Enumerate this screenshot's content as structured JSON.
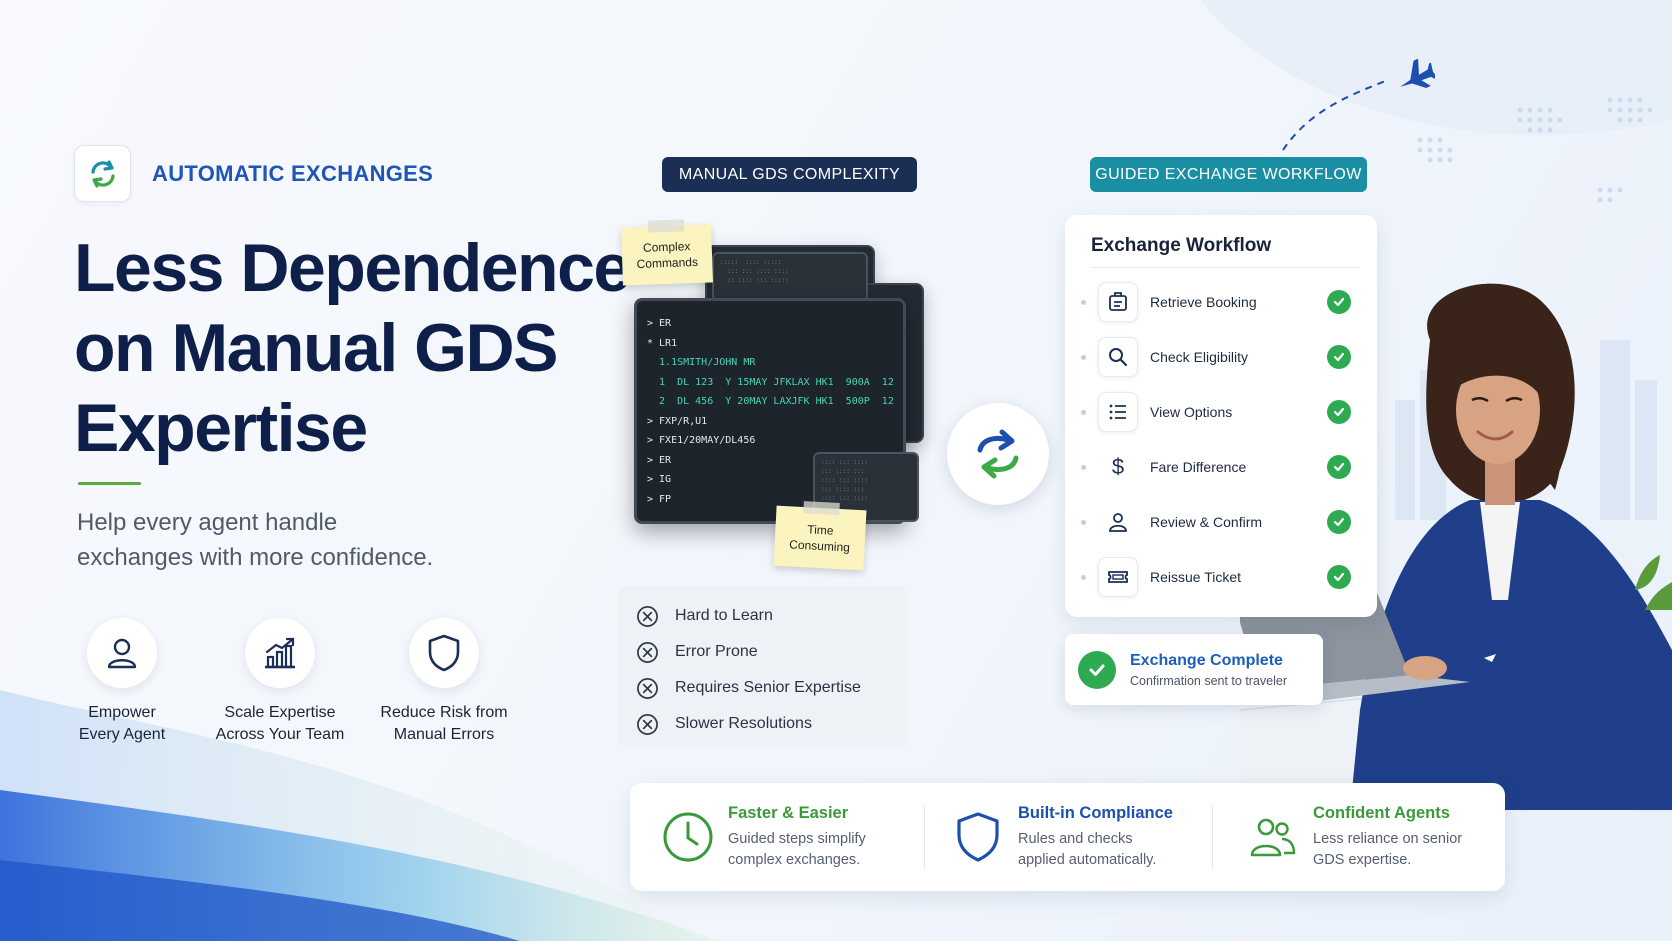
{
  "brand": {
    "label": "AUTOMATIC EXCHANGES",
    "icon": "sync-icon"
  },
  "headline": {
    "line1": "Less Dependence",
    "line2": "on Manual GDS",
    "line3": "Expertise"
  },
  "subtitle": {
    "line1": "Help every agent handle",
    "line2": "exchanges with more confidence."
  },
  "benefits": [
    {
      "icon": "user-icon",
      "line1": "Empower",
      "line2": "Every Agent"
    },
    {
      "icon": "growth-chart-icon",
      "line1": "Scale Expertise",
      "line2": "Across Your Team"
    },
    {
      "icon": "shield-icon",
      "line1": "Reduce Risk from",
      "line2": "Manual Errors"
    }
  ],
  "manual": {
    "pill": "MANUAL GDS COMPLEXITY",
    "sticky_top": {
      "line1": "Complex",
      "line2": "Commands"
    },
    "sticky_bottom": {
      "line1": "Time",
      "line2": "Consuming"
    },
    "terminal_lines": [
      "> ER",
      "* LR1",
      "  1.1SMITH/JOHN MR",
      "  1  DL 123  Y 15MAY JFKLAX HK1  900A  12",
      "  2  DL 456  Y 20MAY LAXJFK HK1  500P  12",
      "> FXP/R,U1",
      "> FXE1/20MAY/DL456",
      "> ER",
      "> IG",
      "> FP"
    ],
    "issues": [
      "Hard to Learn",
      "Error Prone",
      "Requires Senior Expertise",
      "Slower Resolutions"
    ]
  },
  "guided": {
    "pill": "GUIDED EXCHANGE WORKFLOW",
    "card_title": "Exchange Workflow",
    "steps": [
      {
        "icon": "booking-icon",
        "label": "Retrieve Booking"
      },
      {
        "icon": "search-icon",
        "label": "Check Eligibility"
      },
      {
        "icon": "list-icon",
        "label": "View Options"
      },
      {
        "icon": "dollar-icon",
        "label": "Fare Difference"
      },
      {
        "icon": "user-icon",
        "label": "Review & Confirm"
      },
      {
        "icon": "ticket-icon",
        "label": "Reissue Ticket"
      }
    ],
    "complete_title": "Exchange Complete",
    "complete_sub": "Confirmation sent to traveler"
  },
  "features": [
    {
      "icon": "clock-icon",
      "title": "Faster & Easier",
      "line1": "Guided steps simplify",
      "line2": "complex exchanges.",
      "color": "#3a9a3a"
    },
    {
      "icon": "shield-icon",
      "title": "Built-in Compliance",
      "line1": "Rules and checks",
      "line2": "applied automatically.",
      "color": "#1d4fae"
    },
    {
      "icon": "team-icon",
      "title": "Confident Agents",
      "line1": "Less reliance on senior",
      "line2": "GDS expertise.",
      "color": "#3a9a3a"
    }
  ],
  "colors": {
    "navy": "#0e1f4a",
    "brand_blue": "#1d55b8",
    "teal": "#1a8fa3",
    "green": "#2eaa52"
  }
}
